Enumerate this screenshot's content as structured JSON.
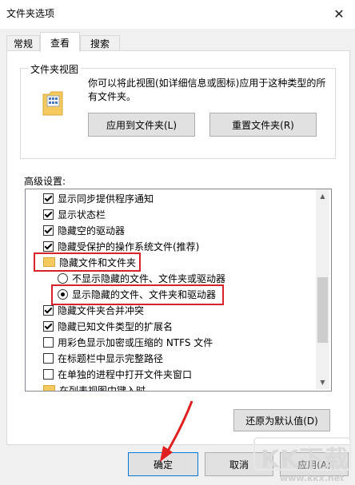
{
  "window": {
    "title": "文件夹选项",
    "close_glyph": "✕"
  },
  "tabs": [
    {
      "label": "常规",
      "active": false
    },
    {
      "label": "查看",
      "active": true
    },
    {
      "label": "搜索",
      "active": false
    }
  ],
  "folder_views": {
    "group_label": "文件夹视图",
    "description": "你可以将此视图(如详细信息或图标)应用于这种类型的所有文件夹。",
    "apply_button": "应用到文件夹(L)",
    "reset_button": "重置文件夹(R)"
  },
  "advanced": {
    "label": "高级设置:",
    "items": [
      {
        "type": "checkbox",
        "checked": true,
        "label": "显示同步提供程序通知"
      },
      {
        "type": "checkbox",
        "checked": true,
        "label": "显示状态栏"
      },
      {
        "type": "checkbox",
        "checked": true,
        "label": "隐藏空的驱动器"
      },
      {
        "type": "checkbox",
        "checked": true,
        "label": "隐藏受保护的操作系统文件(推荐)"
      },
      {
        "type": "folder",
        "label": "隐藏文件和文件夹"
      },
      {
        "type": "radio",
        "checked": false,
        "label": "不显示隐藏的文件、文件夹或驱动器"
      },
      {
        "type": "radio",
        "checked": true,
        "label": "显示隐藏的文件、文件夹和驱动器"
      },
      {
        "type": "checkbox",
        "checked": true,
        "label": "隐藏文件夹合并冲突"
      },
      {
        "type": "checkbox",
        "checked": true,
        "label": "隐藏已知文件类型的扩展名"
      },
      {
        "type": "checkbox",
        "checked": false,
        "label": "用彩色显示加密或压缩的 NTFS 文件"
      },
      {
        "type": "checkbox",
        "checked": false,
        "label": "在标题栏中显示完整路径"
      },
      {
        "type": "checkbox",
        "checked": false,
        "label": "在单独的进程中打开文件夹窗口"
      },
      {
        "type": "folder",
        "label": "在列表视图中键入时"
      }
    ],
    "restore_button": "还原为默认值(D)"
  },
  "footer": {
    "ok_button": "确定",
    "cancel_button": "取消",
    "apply_button": "应用(A)"
  },
  "watermark": {
    "text": "KK下载",
    "url": "www.kkx.net"
  },
  "colors": {
    "highlight": "#d8232a",
    "arrow": "#e02020"
  }
}
